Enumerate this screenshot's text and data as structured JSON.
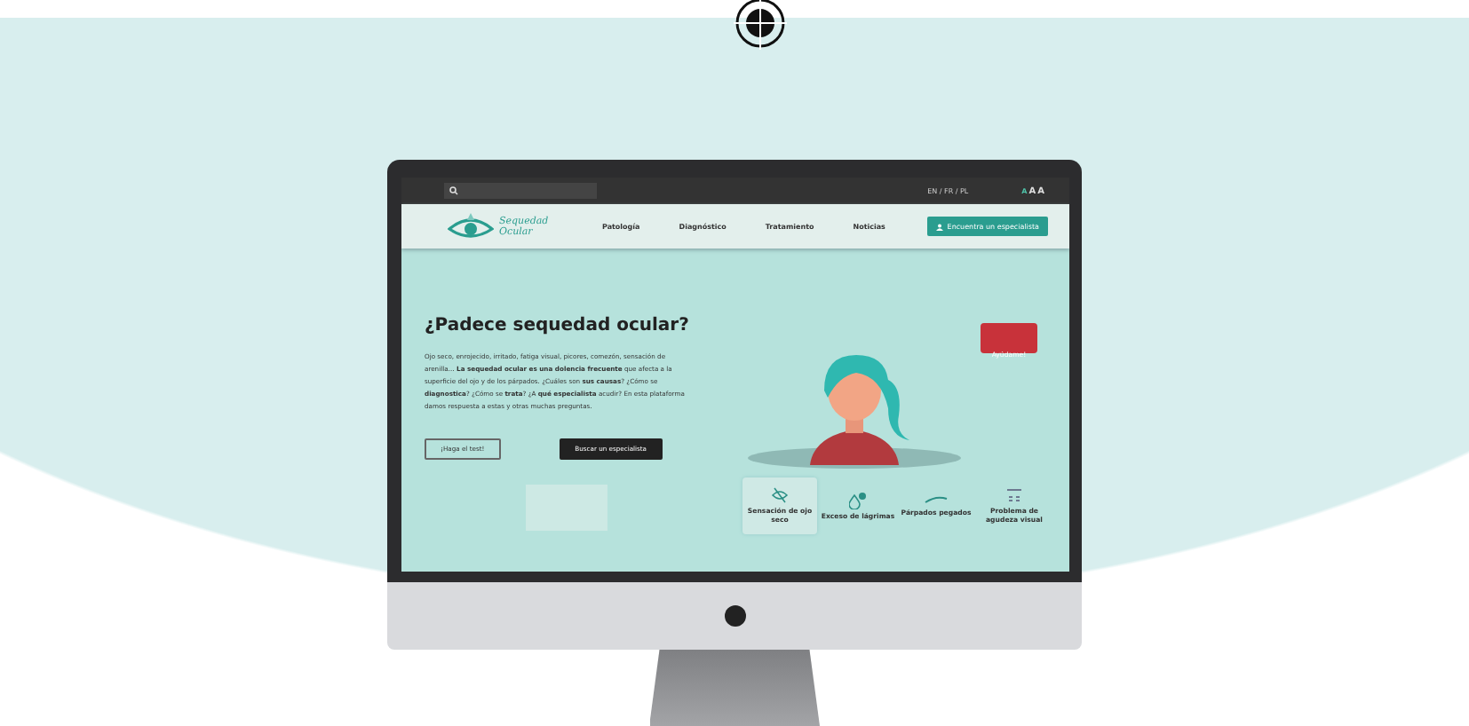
{
  "top_bar": {
    "languages": "EN / FR / PL",
    "text_sizes": [
      {
        "label": "A",
        "selected": true
      },
      {
        "label": "A",
        "selected": false
      },
      {
        "label": "A",
        "selected": false
      }
    ]
  },
  "nav": {
    "logo": "Sequedad Ocular",
    "items": [
      "Patología",
      "Diagnóstico",
      "Tratamiento",
      "Noticias"
    ],
    "cta": "Encuentra un especialista"
  },
  "hero": {
    "title": "¿Padece sequedad ocular?",
    "text": "Ojo seco, enrojecido, irritado, fatiga visual, picores, comezón, sensación de arenilla… **La sequedad ocular es una dolencia frecuente** que afecta a la superficie del ojo y de los párpados. ¿Cuáles son **sus causas**? ¿Cómo se **diagnostica**? ¿Cómo se **trata**? ¿A **qué especialista** acudir? En esta plataforma damos respuesta a estas y otras muchas preguntas.",
    "buttons": [
      {
        "label": "¡Haga el test!",
        "kind": "outline"
      },
      {
        "label": "Buscar un especialista",
        "kind": "dark"
      }
    ],
    "help_badge": "Ayúdame!"
  },
  "symptoms": [
    {
      "label": "Sensación de ojo seco",
      "kind": "dry",
      "selected": true
    },
    {
      "label": "Exceso de lágrimas",
      "kind": "tears",
      "selected": false
    },
    {
      "label": "Párpados pegados",
      "kind": "lids",
      "selected": false
    },
    {
      "label": "Problema de agudeza visual",
      "kind": "vision",
      "selected": false
    }
  ]
}
